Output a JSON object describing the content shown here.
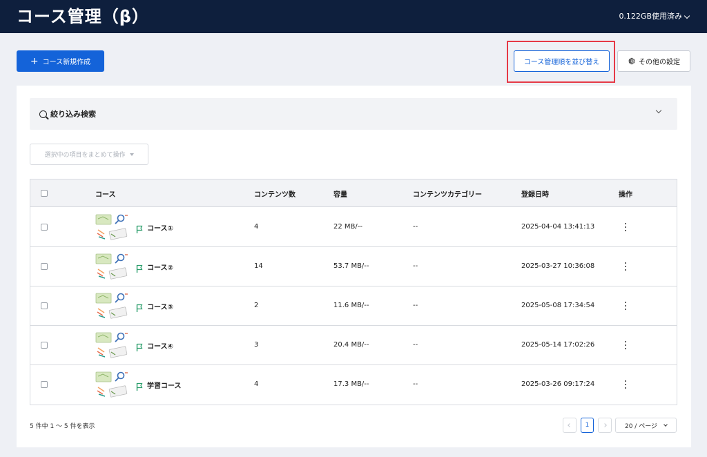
{
  "header": {
    "title": "コース管理（β）",
    "usage": "0.122GB使用済み"
  },
  "toolbar": {
    "create_label": "コース新規作成",
    "sort_label": "コース管理順を並び替え",
    "settings_label": "その他の設定"
  },
  "search": {
    "label": "絞り込み検索"
  },
  "bulk_action": {
    "placeholder": "選択中の項目をまとめて操作"
  },
  "table": {
    "columns": [
      "コース",
      "コンテンツ数",
      "容量",
      "コンテンツカテゴリー",
      "登録日時",
      "操作"
    ],
    "rows": [
      {
        "name": "コース①",
        "contents": "4",
        "size": "22 MB/--",
        "category": "--",
        "date": "2025-04-04 13:41:13"
      },
      {
        "name": "コース②",
        "contents": "14",
        "size": "53.7 MB/--",
        "category": "--",
        "date": "2025-03-27 10:36:08"
      },
      {
        "name": "コース③",
        "contents": "2",
        "size": "11.6 MB/--",
        "category": "--",
        "date": "2025-05-08 17:34:54"
      },
      {
        "name": "コース④",
        "contents": "3",
        "size": "20.4 MB/--",
        "category": "--",
        "date": "2025-05-14 17:02:26"
      },
      {
        "name": "学習コース",
        "contents": "4",
        "size": "17.3 MB/--",
        "category": "--",
        "date": "2025-03-26 09:17:24"
      }
    ]
  },
  "footer": {
    "summary": "5 件中 1 ～ 5 件を表示",
    "current_page": "1",
    "page_size": "20 / ページ"
  },
  "colors": {
    "header_bg": "#0e1f3d",
    "primary": "#1463d9",
    "highlight": "#e63946",
    "flag": "#2a9d6a"
  }
}
